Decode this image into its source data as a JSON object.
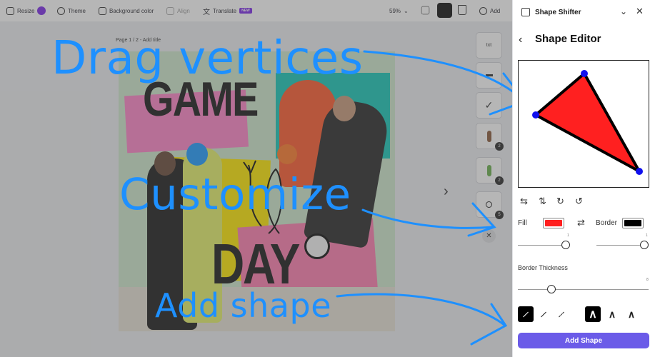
{
  "toolbar": {
    "resize": "Resize",
    "theme": "Theme",
    "background_color": "Background color",
    "align": "Align",
    "translate": "Translate",
    "translate_badge": "NEW",
    "zoom": "59%",
    "add": "Add"
  },
  "canvas": {
    "page_label": "Page 1 / 2 - Add title",
    "poster_title_top": "GAME",
    "poster_title_bottom": "DAY",
    "thumbnails": [
      {
        "label": "txt",
        "badge": ""
      },
      {
        "label": "",
        "badge": ""
      },
      {
        "label": "",
        "badge": ""
      },
      {
        "label": "",
        "badge": "2"
      },
      {
        "label": "",
        "badge": "2"
      },
      {
        "label": "",
        "badge": "5"
      }
    ],
    "close_symbol": "✕",
    "next_symbol": "›"
  },
  "callouts": {
    "drag": "Drag vertices",
    "customize": "Customize",
    "add_shape": "Add shape",
    "color": "#1e90ff"
  },
  "panel": {
    "app_title": "Shape Shifter",
    "editor_title": "Shape Editor",
    "fill_label": "Fill",
    "fill_color": "#ff1f1f",
    "border_label": "Border",
    "border_color": "#000000",
    "fill_opacity": 1,
    "border_opacity": 1,
    "border_thickness_label": "Border Thickness",
    "border_thickness": 8,
    "add_shape_button": "Add Shape",
    "shape_fill": "#ff2020",
    "vertex_color": "#1010ee"
  }
}
